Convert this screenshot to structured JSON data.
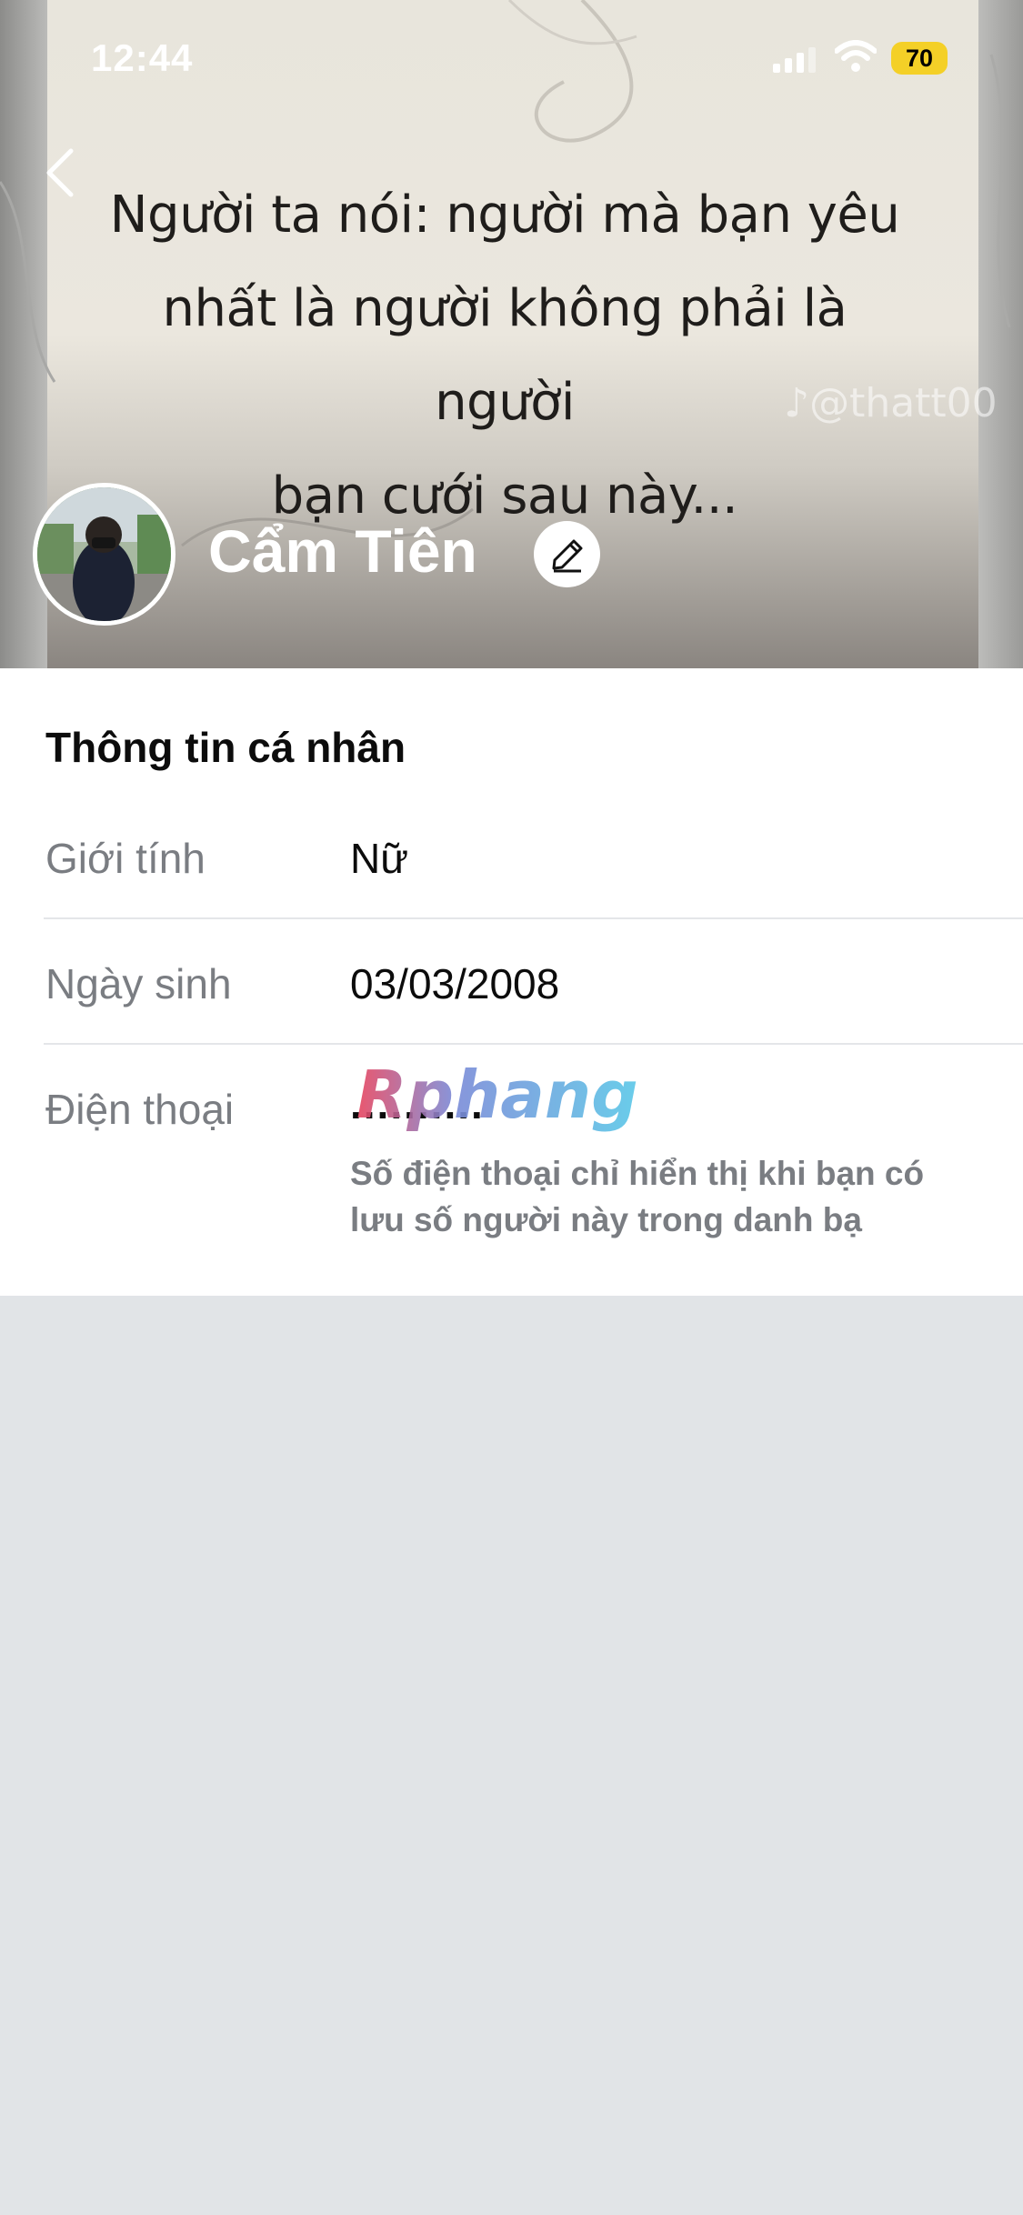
{
  "status_bar": {
    "time": "12:44",
    "battery": "70",
    "icons": [
      "signal-icon",
      "wifi-icon",
      "battery-icon"
    ]
  },
  "cover": {
    "quote_lines": [
      "Người ta nói: người mà bạn yêu",
      "nhất là người không phải là người",
      "bạn cưới sau này..."
    ],
    "watermark": "♪@thatt00"
  },
  "profile": {
    "name": "Cẩm Tiên"
  },
  "personal_info": {
    "title": "Thông tin cá nhân",
    "rows": [
      {
        "label": "Giới tính",
        "value": "Nữ"
      },
      {
        "label": "Ngày sinh",
        "value": "03/03/2008"
      },
      {
        "label": "Điện thoại",
        "value": "..........",
        "note": "Số điện thoại chỉ hiển thị khi bạn có lưu số người này trong danh bạ"
      }
    ]
  },
  "overlay_logo": "Rphang",
  "colors": {
    "accent_battery": "#f4d027",
    "label_gray": "#7a7d82",
    "background": "#e1e4e7"
  }
}
